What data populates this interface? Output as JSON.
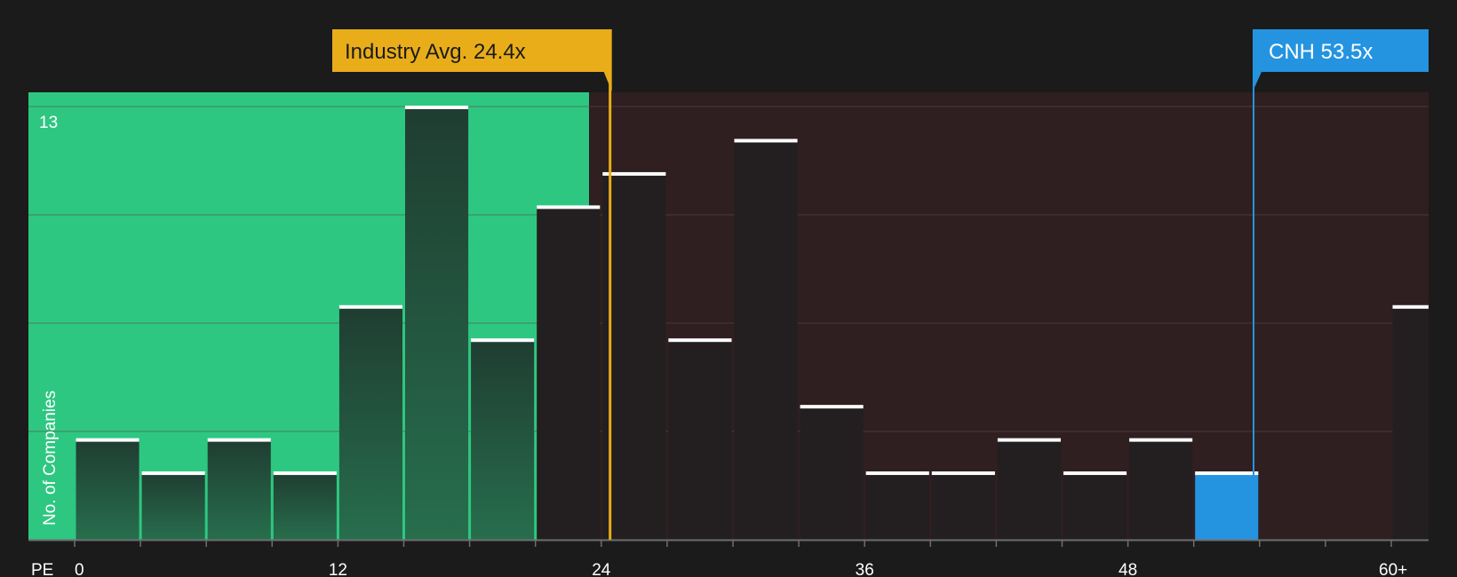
{
  "chart_data": {
    "type": "bar",
    "xlabel": "PE",
    "ylabel": "No. of Companies",
    "y_tick_label": "13",
    "ylim": [
      0,
      13.4
    ],
    "x_ticks": [
      {
        "value": 0,
        "label": "0"
      },
      {
        "value": 12,
        "label": "12"
      },
      {
        "value": 24,
        "label": "24"
      },
      {
        "value": 36,
        "label": "36"
      },
      {
        "value": 48,
        "label": "48"
      },
      {
        "value": 60,
        "label": "60+"
      }
    ],
    "bin_width": 3,
    "bins": [
      {
        "x0": 0,
        "count": 3
      },
      {
        "x0": 3,
        "count": 2
      },
      {
        "x0": 6,
        "count": 3
      },
      {
        "x0": 9,
        "count": 2
      },
      {
        "x0": 12,
        "count": 7
      },
      {
        "x0": 15,
        "count": 13
      },
      {
        "x0": 18,
        "count": 6
      },
      {
        "x0": 21,
        "count": 10
      },
      {
        "x0": 24,
        "count": 11
      },
      {
        "x0": 27,
        "count": 6
      },
      {
        "x0": 30,
        "count": 12
      },
      {
        "x0": 33,
        "count": 4
      },
      {
        "x0": 36,
        "count": 2
      },
      {
        "x0": 39,
        "count": 2
      },
      {
        "x0": 42,
        "count": 3
      },
      {
        "x0": 45,
        "count": 2
      },
      {
        "x0": 48,
        "count": 3
      },
      {
        "x0": 51,
        "count": 2,
        "highlight": true
      },
      {
        "x0": 54,
        "count": 0
      },
      {
        "x0": 57,
        "count": 0
      },
      {
        "x0": 60,
        "count": 7
      }
    ],
    "industry_avg": {
      "value": 24.4,
      "label": "Industry Avg. 24.4x"
    },
    "company": {
      "value": 53.5,
      "label": "CNH 53.5x"
    },
    "colors": {
      "background": "#1b1b1b",
      "undervalued_region": "#2ec781",
      "overvalued_region": "#2f1f21",
      "bar_left": "#1f4d38",
      "bar_right": "#231e1f",
      "bar_top": "#ffffff",
      "highlight": "#2494e1",
      "industry": "#e9ad1a",
      "gridline": "#5a4a4c"
    }
  }
}
